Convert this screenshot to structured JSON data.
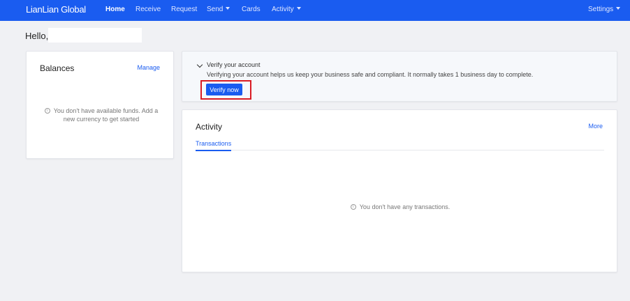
{
  "nav": {
    "brand": "LianLian Global",
    "items": [
      {
        "label": "Home",
        "active": true,
        "dropdown": false
      },
      {
        "label": "Receive",
        "active": false,
        "dropdown": false
      },
      {
        "label": "Request",
        "active": false,
        "dropdown": false
      },
      {
        "label": "Send",
        "active": false,
        "dropdown": true
      },
      {
        "label": "Cards",
        "active": false,
        "dropdown": false
      },
      {
        "label": "Activity",
        "active": false,
        "dropdown": true
      }
    ],
    "settings": "Settings"
  },
  "greeting": "Hello,",
  "balances": {
    "title": "Balances",
    "manage": "Manage",
    "empty": "You don't have available funds. Add a new currency to get started"
  },
  "verify": {
    "title": "Verify your account",
    "description": "Verifying your account helps us keep your business safe and compliant. It normally takes 1 business day to complete.",
    "button": "Verify now"
  },
  "activity": {
    "title": "Activity",
    "more": "More",
    "tab": "Transactions",
    "empty": "You don't have any transactions."
  },
  "colors": {
    "primary": "#1a5cf0",
    "highlight": "#d91c24",
    "background": "#f0f1f4"
  }
}
